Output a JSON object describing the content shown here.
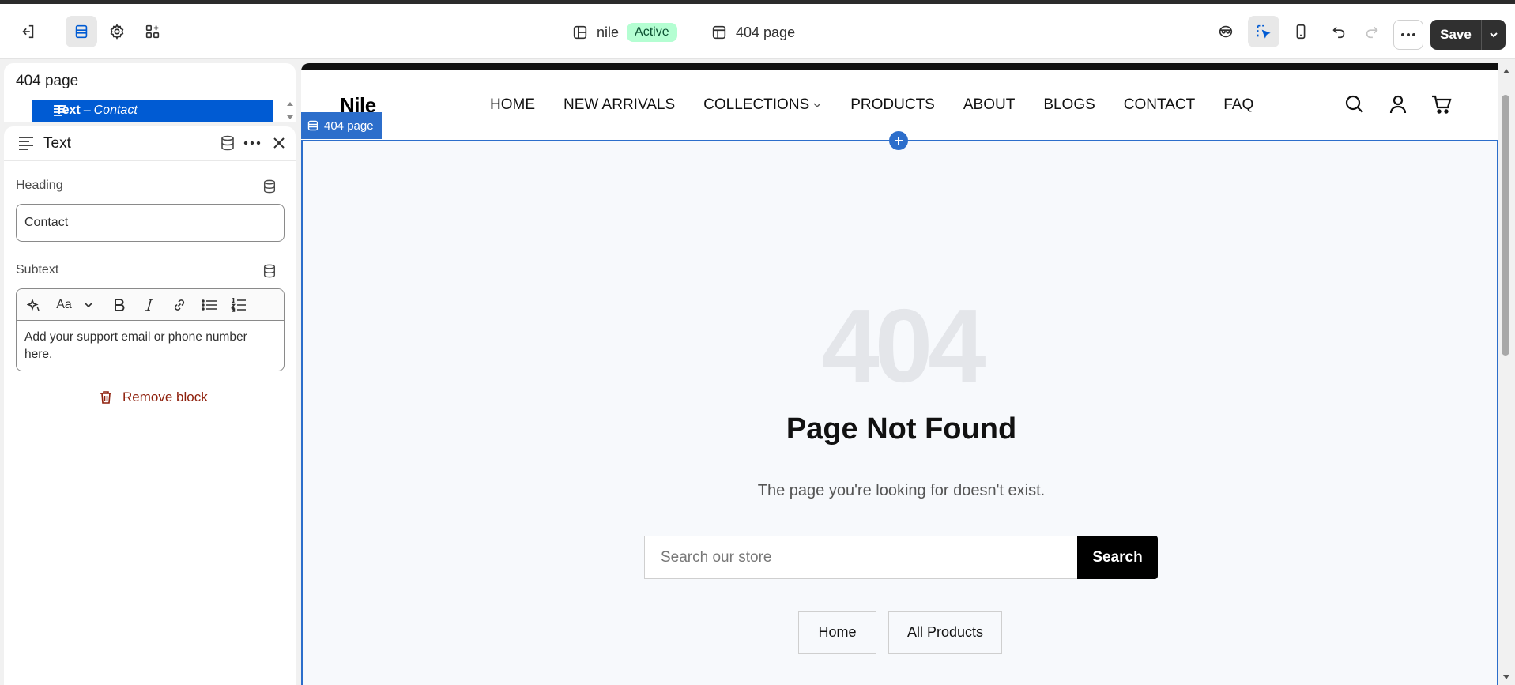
{
  "topbar": {
    "theme_name": "nile",
    "theme_status": "Active",
    "template_name": "404 page",
    "save_label": "Save"
  },
  "left_tree": {
    "title": "404 page",
    "selected_item_type": "Text",
    "selected_item_sep": "–",
    "selected_item_name": "Contact"
  },
  "block_panel": {
    "title": "Text",
    "heading_label": "Heading",
    "heading_value": "Contact",
    "subtext_label": "Subtext",
    "subtext_value": "Add your support email or phone number here.",
    "font_tool_label": "Aa",
    "remove_label": "Remove block"
  },
  "store": {
    "logo": "Nile",
    "nav": [
      {
        "label": "HOME"
      },
      {
        "label": "NEW ARRIVALS"
      },
      {
        "label": "COLLECTIONS"
      },
      {
        "label": "PRODUCTS"
      },
      {
        "label": "ABOUT"
      },
      {
        "label": "BLOGS"
      },
      {
        "label": "CONTACT"
      },
      {
        "label": "FAQ"
      }
    ]
  },
  "section": {
    "tag": "404 page",
    "code": "404",
    "title": "Page Not Found",
    "subtitle": "The page you're looking for doesn't exist.",
    "search_placeholder": "Search our store",
    "search_button": "Search",
    "home_button": "Home",
    "products_button": "All Products"
  },
  "colors": {
    "accent": "#2c6ecb",
    "selected": "#005bd3",
    "badge_bg": "#b4fed2",
    "danger": "#8e1f0b"
  }
}
